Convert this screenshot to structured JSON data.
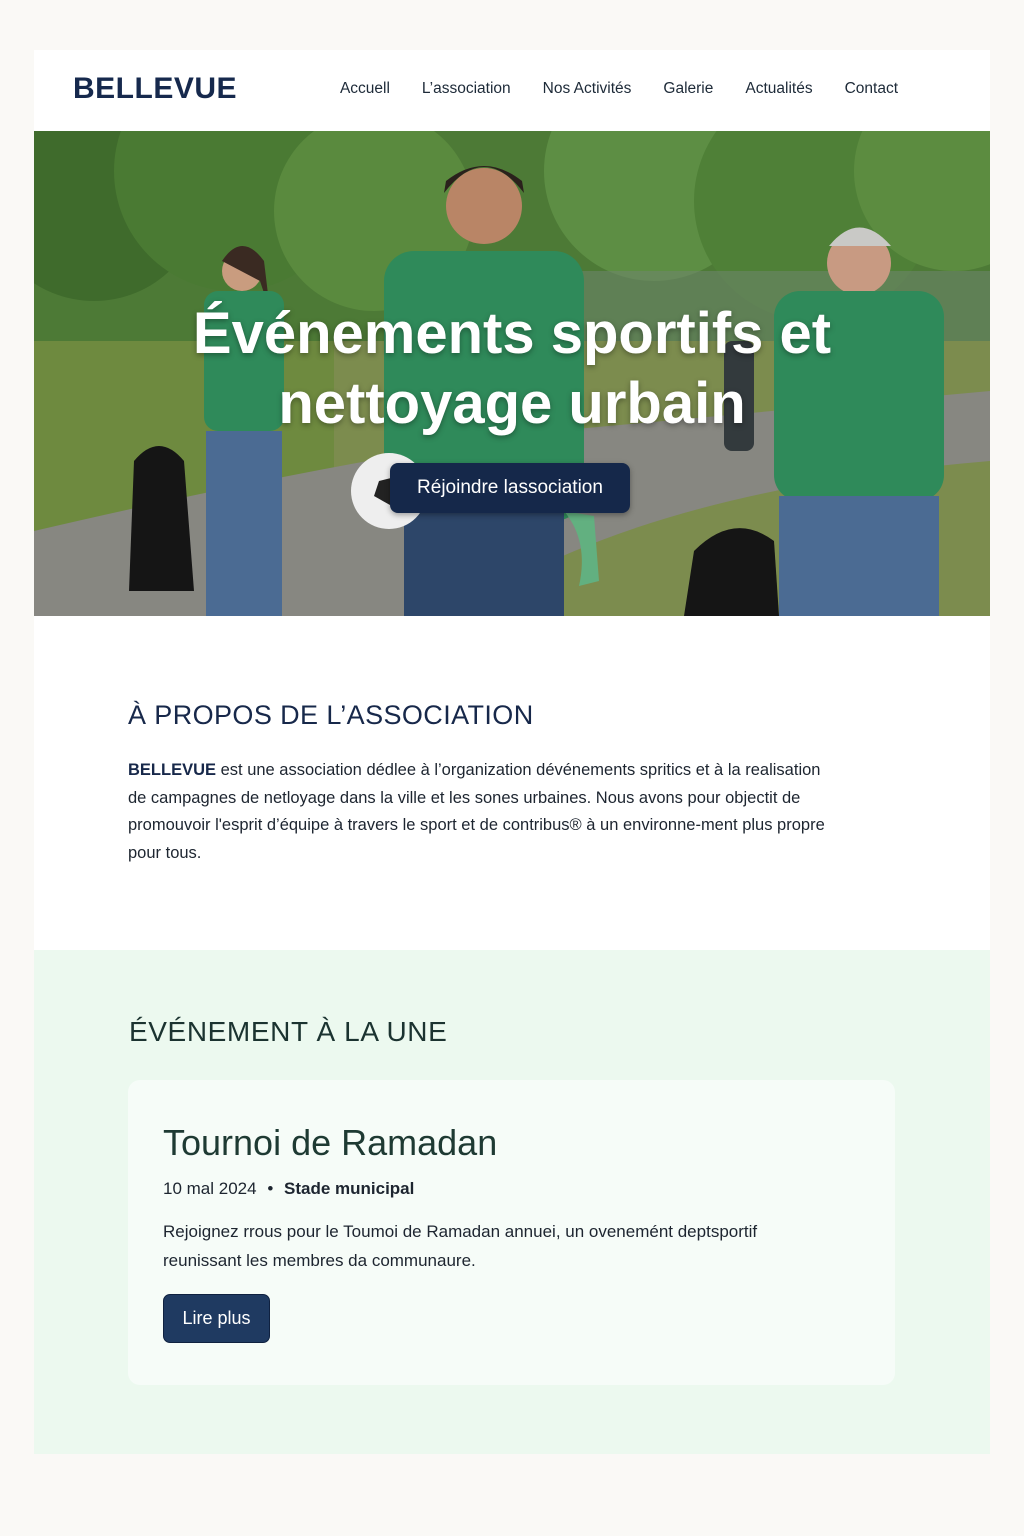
{
  "header": {
    "logo": "BELLEVUE",
    "nav": [
      "Accuell",
      "L’association",
      "Nos Activités",
      "Galerie",
      "Actualités",
      "Contact"
    ]
  },
  "hero": {
    "title": "Événements sportifs et nettoyage urbain",
    "cta_label": "Réjoindre lassociation"
  },
  "about": {
    "title": "À PROPOS DE L’ASSOCIATION",
    "brand": "BELLEVUE",
    "text": " est une association dédlee à l’organization dévénements spritics et à la realisation de campagnes de netloyage dans la ville et les sones urbaines. Nous avons pour objectit de promouvoir l'esprit d’équipe à travers le sport et de contribus® à un environne-ment plus propre pour tous."
  },
  "featured": {
    "section_title": "ÉVÉNEMENT À LA UNE",
    "event_title": "Tournoi de Ramadan",
    "date": "10 mal 2024",
    "separator": "•",
    "location": "Stade municipal",
    "description": "Rejoignez rrous pour le Toumoi de Ramadan annuei, un ovenemént deptsportif reunissant les membres da communaure.",
    "read_more": "Lire plus"
  },
  "colors": {
    "navy": "#15284a",
    "event_bg": "#ecf9ef",
    "card_bg": "#f6fcf8",
    "shirt_green": "#2f8a5a"
  }
}
